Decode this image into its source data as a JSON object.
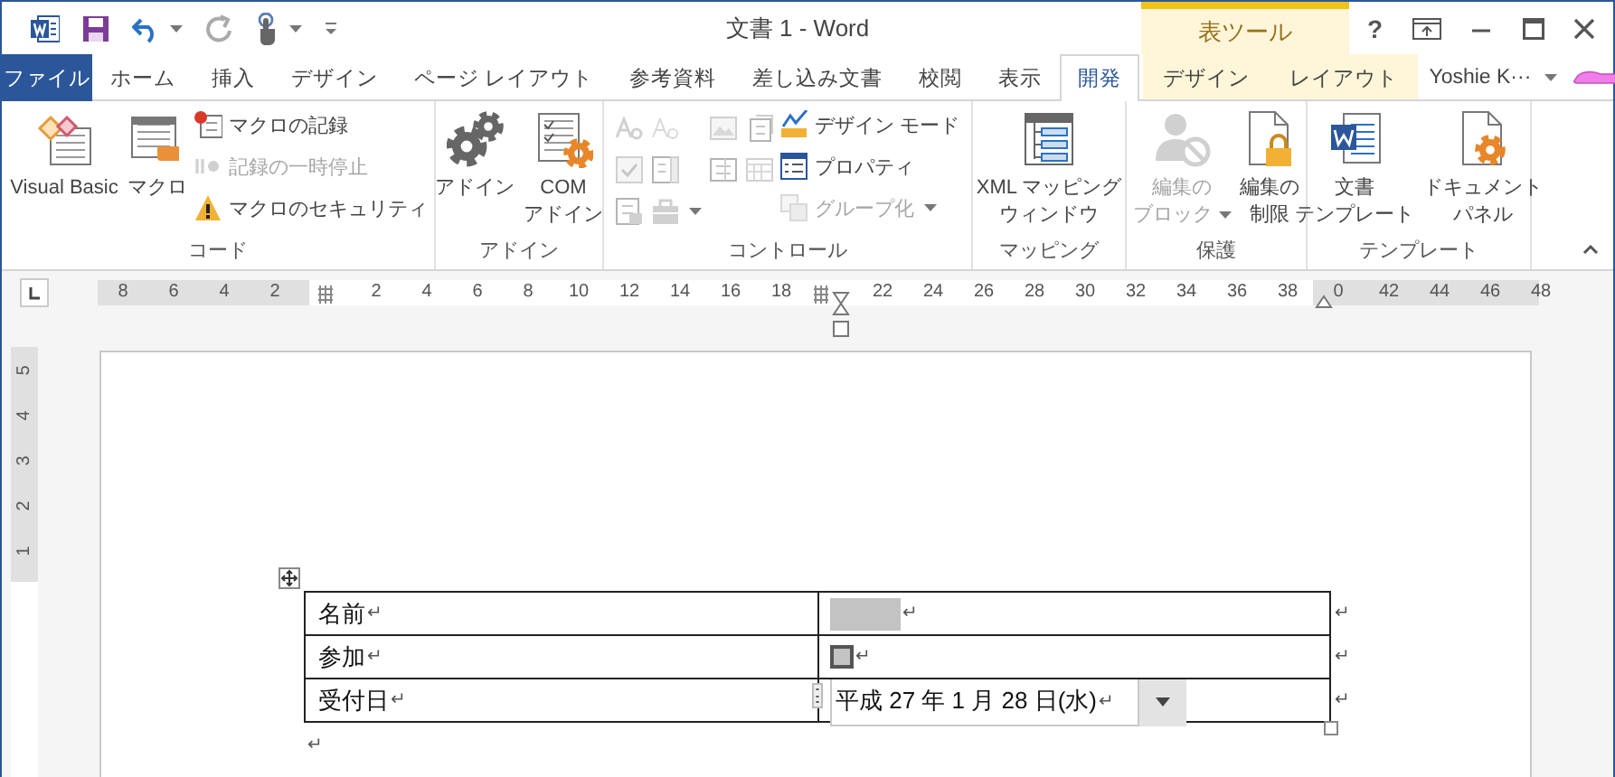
{
  "window": {
    "title": "文書 1 - Word",
    "help": "?"
  },
  "context_tab_group": {
    "label": "表ツール"
  },
  "tabs": [
    {
      "label": "ファイル",
      "kind": "file",
      "selected": false
    },
    {
      "label": "ホーム",
      "kind": "normal",
      "selected": false
    },
    {
      "label": "挿入",
      "kind": "normal",
      "selected": false
    },
    {
      "label": "デザイン",
      "kind": "normal",
      "selected": false
    },
    {
      "label": "ページ レイアウト",
      "kind": "normal",
      "selected": false
    },
    {
      "label": "参考資料",
      "kind": "normal",
      "selected": false
    },
    {
      "label": "差し込み文書",
      "kind": "normal",
      "selected": false
    },
    {
      "label": "校閲",
      "kind": "normal",
      "selected": false
    },
    {
      "label": "表示",
      "kind": "normal",
      "selected": false
    },
    {
      "label": "開発",
      "kind": "normal",
      "selected": true
    },
    {
      "label": "デザイン",
      "kind": "contextual",
      "selected": false
    },
    {
      "label": "レイアウト",
      "kind": "contextual",
      "selected": false
    }
  ],
  "account": {
    "name": "Yoshie K···"
  },
  "ribbon_groups": [
    {
      "label": "コード",
      "items": [
        {
          "kind": "large",
          "lines": [
            "Visual Basic"
          ],
          "disabled": false,
          "dropdown": false
        },
        {
          "kind": "large",
          "lines": [
            "マクロ"
          ],
          "disabled": false,
          "dropdown": false
        },
        {
          "kind": "small",
          "label": "マクロの記録",
          "disabled": false,
          "dropdown": false
        },
        {
          "kind": "small",
          "label": "記録の一時停止",
          "disabled": true,
          "dropdown": false
        },
        {
          "kind": "small",
          "label": "マクロのセキュリティ",
          "disabled": false,
          "dropdown": false
        }
      ]
    },
    {
      "label": "アドイン",
      "items": [
        {
          "kind": "large",
          "lines": [
            "アドイン"
          ],
          "disabled": false,
          "dropdown": false
        },
        {
          "kind": "large",
          "lines": [
            "COM",
            "アドイン"
          ],
          "disabled": false,
          "dropdown": false
        }
      ]
    },
    {
      "label": "コントロール",
      "items": [
        {
          "kind": "icon",
          "disabled": true,
          "dropdown": false
        },
        {
          "kind": "icon",
          "disabled": true,
          "dropdown": false
        },
        {
          "kind": "icon",
          "disabled": true,
          "dropdown": false
        },
        {
          "kind": "icon",
          "disabled": true,
          "dropdown": false
        },
        {
          "kind": "icon",
          "disabled": true,
          "dropdown": false
        },
        {
          "kind": "icon",
          "disabled": true,
          "dropdown": false
        },
        {
          "kind": "icon",
          "disabled": true,
          "dropdown": false
        },
        {
          "kind": "icon",
          "disabled": true,
          "dropdown": false
        },
        {
          "kind": "icon",
          "disabled": true,
          "dropdown": false
        },
        {
          "kind": "icon",
          "disabled": true,
          "dropdown": true
        },
        {
          "kind": "small",
          "label": "デザイン モード",
          "disabled": false,
          "dropdown": false
        },
        {
          "kind": "small",
          "label": "プロパティ",
          "disabled": false,
          "dropdown": false
        },
        {
          "kind": "small",
          "label": "グループ化",
          "disabled": true,
          "dropdown": true
        }
      ]
    },
    {
      "label": "マッピング",
      "items": [
        {
          "kind": "large",
          "lines": [
            "XML マッピング",
            "ウィンドウ"
          ],
          "disabled": false,
          "dropdown": false
        }
      ]
    },
    {
      "label": "保護",
      "items": [
        {
          "kind": "large",
          "lines": [
            "編集の",
            "ブロック"
          ],
          "disabled": true,
          "dropdown": true
        },
        {
          "kind": "large",
          "lines": [
            "編集の",
            "制限"
          ],
          "disabled": false,
          "dropdown": false
        }
      ]
    },
    {
      "label": "テンプレート",
      "items": [
        {
          "kind": "large",
          "lines": [
            "文書",
            "テンプレート"
          ],
          "disabled": false,
          "dropdown": false
        },
        {
          "kind": "large",
          "lines": [
            "ドキュメント",
            "パネル"
          ],
          "disabled": false,
          "dropdown": false
        }
      ]
    }
  ],
  "ruler": {
    "marks": [
      {
        "kind": "number",
        "text": "8"
      },
      {
        "kind": "number",
        "text": "6"
      },
      {
        "kind": "number",
        "text": "4"
      },
      {
        "kind": "number",
        "text": "2"
      },
      {
        "kind": "column"
      },
      {
        "kind": "number",
        "text": "2"
      },
      {
        "kind": "number",
        "text": "4"
      },
      {
        "kind": "number",
        "text": "6"
      },
      {
        "kind": "number",
        "text": "8"
      },
      {
        "kind": "number",
        "text": "10"
      },
      {
        "kind": "number",
        "text": "12"
      },
      {
        "kind": "number",
        "text": "14"
      },
      {
        "kind": "number",
        "text": "16"
      },
      {
        "kind": "number",
        "text": "18"
      },
      {
        "kind": "column-indent"
      },
      {
        "kind": "number",
        "text": "22"
      },
      {
        "kind": "number",
        "text": "24"
      },
      {
        "kind": "number",
        "text": "26"
      },
      {
        "kind": "number",
        "text": "28"
      },
      {
        "kind": "number",
        "text": "30"
      },
      {
        "kind": "number",
        "text": "32"
      },
      {
        "kind": "number",
        "text": "34"
      },
      {
        "kind": "number",
        "text": "36"
      },
      {
        "kind": "number",
        "text": "38"
      },
      {
        "kind": "indent-number",
        "text": "0"
      },
      {
        "kind": "number",
        "text": "42"
      },
      {
        "kind": "number",
        "text": "44"
      },
      {
        "kind": "number",
        "text": "46"
      },
      {
        "kind": "number",
        "text": "48"
      }
    ]
  },
  "vertical_ruler": {
    "labels": [
      "5",
      "4",
      "3",
      "2",
      "1"
    ]
  },
  "table": {
    "rows": [
      {
        "label": "名前",
        "label_mark": "↵",
        "control": {
          "kind": "text-field",
          "mark": "↵"
        },
        "end_mark": "↵"
      },
      {
        "label": "参加",
        "label_mark": "↵",
        "control": {
          "kind": "checkbox",
          "checked": false,
          "mark": "↵"
        },
        "end_mark": "↵"
      },
      {
        "label": "受付日",
        "label_mark": "↵",
        "control": {
          "kind": "date-picker",
          "value": "平成 27 年 1 月 28 日(水)",
          "mark": "↵"
        },
        "end_mark": "↵"
      }
    ]
  },
  "after_table_mark": "↵"
}
